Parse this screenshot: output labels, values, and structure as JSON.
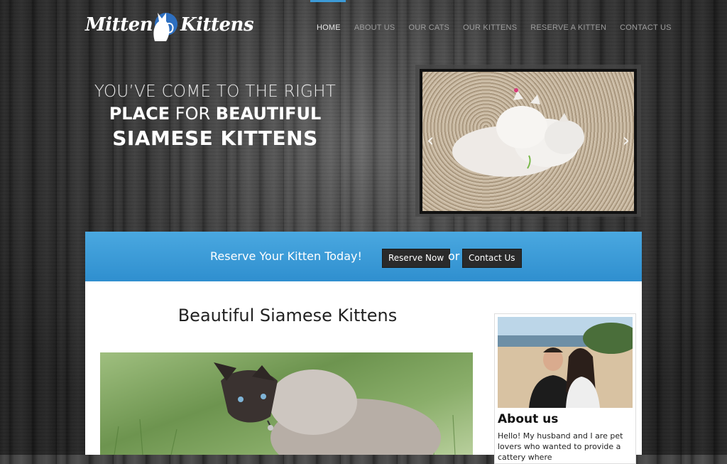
{
  "logo": {
    "word1": "Mitten",
    "word2": "Kittens"
  },
  "nav": {
    "items": [
      {
        "label": "HOME",
        "active": true
      },
      {
        "label": "ABOUT US"
      },
      {
        "label": "OUR CATS"
      },
      {
        "label": "OUR KITTENS"
      },
      {
        "label": "RESERVE A KITTEN"
      },
      {
        "label": "CONTACT US"
      }
    ]
  },
  "hero": {
    "line1": "YOU’VE COME TO THE RIGHT",
    "line2_bold1": "PLACE",
    "line2_mid": " FOR ",
    "line2_bold2": "BEAUTIFUL",
    "line3": "SIAMESE KITTENS"
  },
  "slider": {
    "prev_icon": "‹",
    "next_icon": "›"
  },
  "cta": {
    "message": "Reserve Your Kitten Today!",
    "reserve_button": "Reserve Now",
    "or": "or",
    "contact_button": "Contact Us"
  },
  "main": {
    "title": "Beautiful Siamese Kittens"
  },
  "sidebar": {
    "title": "About us",
    "text": "Hello! My husband and I are pet lovers who wanted to provide a cattery where"
  },
  "colors": {
    "accent": "#3d9ad6",
    "cta_bar": "#3a9bd8",
    "button": "#2a2a2a"
  }
}
